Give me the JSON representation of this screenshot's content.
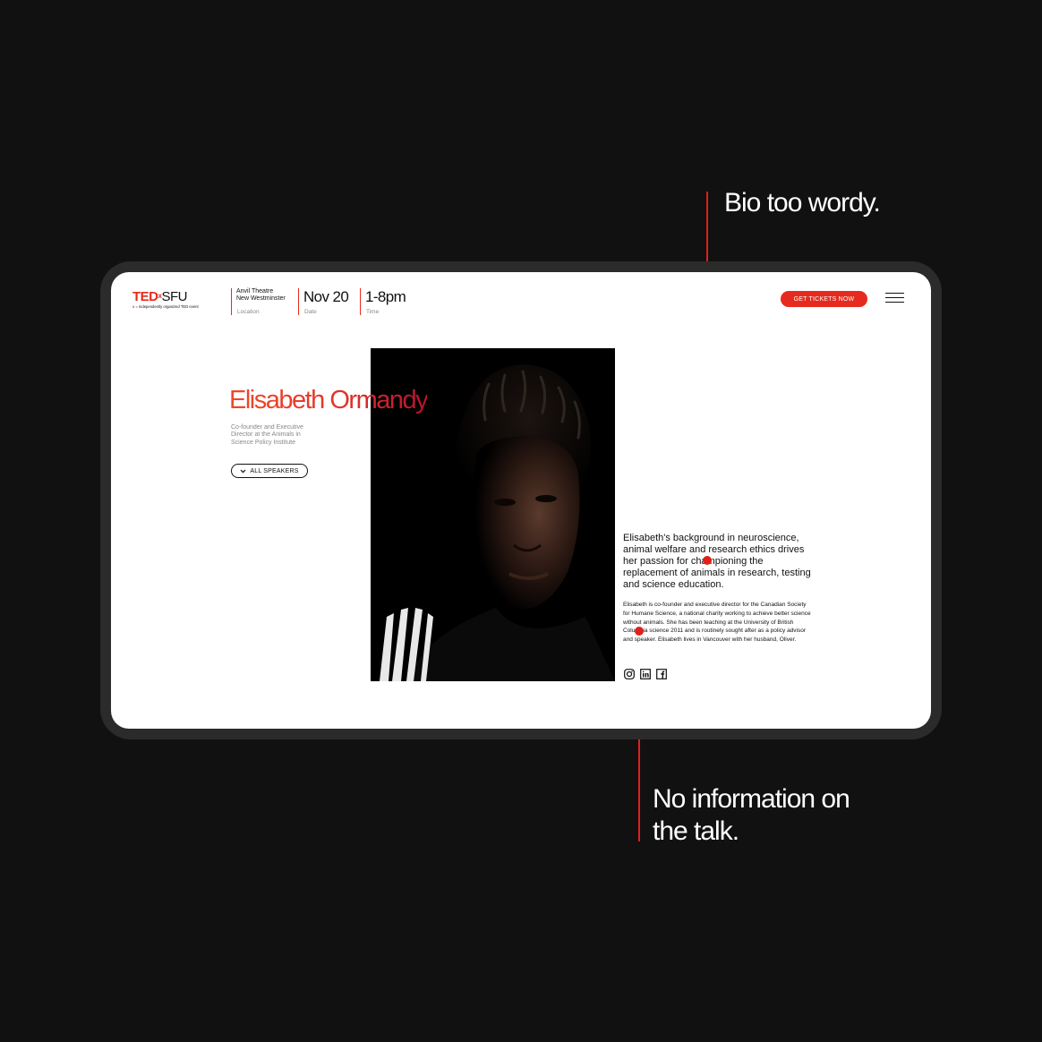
{
  "annotations": {
    "bio_note": "Bio too wordy.",
    "talk_note_line1": "No information on",
    "talk_note_line2": "the talk."
  },
  "header": {
    "logo": {
      "ted": "TED",
      "x": "x",
      "sfu": "SFU",
      "x_tag": "x",
      "subtitle": "= independently organized TED event"
    },
    "location": {
      "line1": "Anvil Theatre",
      "line2": "New Westminster",
      "label": "Location"
    },
    "date": {
      "value": "Nov 20",
      "label": "Date"
    },
    "time": {
      "value": "1-8pm",
      "label": "Time"
    },
    "tickets_label": "GET TICKETS NOW"
  },
  "speaker": {
    "name": "Elisabeth Ormandy",
    "role": "Co-founder and Executive Director at the Animals in Science Policy Institute",
    "all_speakers_label": "ALL SPEAKERS",
    "bio_lead": "Elisabeth's background in neuroscience, animal welfare and research ethics drives her passion for championing the replacement of animals in research, testing and science education.",
    "bio_body": "Elisabeth is co-founder and executive director for the Canadian Society for Humane Science, a national charity working to achieve better science without animals. She has been teaching at the University of British Columbia science 2011 and is routinely sought after as a policy advisor and speaker. Elisabeth lives in Vancouver with her husband, Oliver.",
    "socials": [
      "instagram-icon",
      "linkedin-icon",
      "facebook-icon"
    ]
  },
  "colors": {
    "accent": "#e62b1e",
    "annotation": "#e0201c",
    "background": "#111111",
    "device": "#2b2b2b"
  }
}
